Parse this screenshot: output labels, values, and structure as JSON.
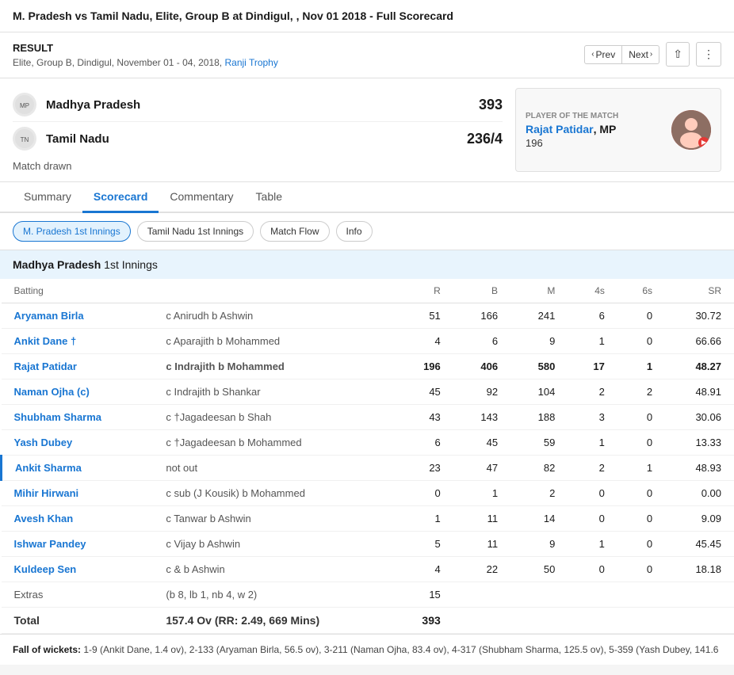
{
  "page": {
    "title": "M. Pradesh vs Tamil Nadu, Elite, Group B at Dindigul, , Nov 01 2018 - Full Scorecard"
  },
  "result": {
    "label": "RESULT",
    "sub": "Elite, Group B, Dindigul, November 01 - 04, 2018,",
    "link_text": "Ranji Trophy",
    "prev_label": "Prev",
    "next_label": "Next"
  },
  "teams": [
    {
      "name": "Madhya Pradesh",
      "score": "393",
      "logo_text": "MP"
    },
    {
      "name": "Tamil Nadu",
      "score": "236/4",
      "logo_text": "TN"
    }
  ],
  "match_result": "Match drawn",
  "player_of_match": {
    "label": "PLAYER OF THE MATCH",
    "name": "Rajat Patidar",
    "team": ", MP",
    "score": "196"
  },
  "tabs": [
    {
      "id": "summary",
      "label": "Summary"
    },
    {
      "id": "scorecard",
      "label": "Scorecard",
      "active": true
    },
    {
      "id": "commentary",
      "label": "Commentary"
    },
    {
      "id": "table",
      "label": "Table"
    }
  ],
  "innings_tabs": [
    {
      "id": "mp1",
      "label": "M. Pradesh 1st Innings",
      "active": true
    },
    {
      "id": "tn1",
      "label": "Tamil Nadu 1st Innings"
    },
    {
      "id": "matchflow",
      "label": "Match Flow"
    },
    {
      "id": "info",
      "label": "Info"
    }
  ],
  "innings": {
    "title_team": "Madhya Pradesh",
    "title_suffix": "1st Innings",
    "batting_headers": {
      "batting": "Batting",
      "r": "R",
      "b": "B",
      "m": "M",
      "fours": "4s",
      "sixes": "6s",
      "sr": "SR"
    },
    "batsmen": [
      {
        "name": "Aryaman Birla",
        "dismissal": "c Anirudh b Ashwin",
        "r": "51",
        "b": "166",
        "m": "241",
        "4s": "6",
        "6s": "0",
        "sr": "30.72",
        "bold": false,
        "highlight_left": false
      },
      {
        "name": "Ankit Dane †",
        "dismissal": "c Aparajith b Mohammed",
        "r": "4",
        "b": "6",
        "m": "9",
        "4s": "1",
        "6s": "0",
        "sr": "66.66",
        "bold": false,
        "highlight_left": false
      },
      {
        "name": "Rajat Patidar",
        "dismissal": "c Indrajith b Mohammed",
        "r": "196",
        "b": "406",
        "m": "580",
        "4s": "17",
        "6s": "1",
        "sr": "48.27",
        "bold": true,
        "highlight_left": false
      },
      {
        "name": "Naman Ojha (c)",
        "dismissal": "c Indrajith b Shankar",
        "r": "45",
        "b": "92",
        "m": "104",
        "4s": "2",
        "6s": "2",
        "sr": "48.91",
        "bold": false,
        "highlight_left": false
      },
      {
        "name": "Shubham Sharma",
        "dismissal": "c †Jagadeesan b Shah",
        "r": "43",
        "b": "143",
        "m": "188",
        "4s": "3",
        "6s": "0",
        "sr": "30.06",
        "bold": false,
        "highlight_left": false
      },
      {
        "name": "Yash Dubey",
        "dismissal": "c †Jagadeesan b Mohammed",
        "r": "6",
        "b": "45",
        "m": "59",
        "4s": "1",
        "6s": "0",
        "sr": "13.33",
        "bold": false,
        "highlight_left": false
      },
      {
        "name": "Ankit Sharma",
        "dismissal": "not out",
        "r": "23",
        "b": "47",
        "m": "82",
        "4s": "2",
        "6s": "1",
        "sr": "48.93",
        "bold": false,
        "highlight_left": true
      },
      {
        "name": "Mihir Hirwani",
        "dismissal": "c sub (J Kousik) b Mohammed",
        "r": "0",
        "b": "1",
        "m": "2",
        "4s": "0",
        "6s": "0",
        "sr": "0.00",
        "bold": false,
        "highlight_left": false
      },
      {
        "name": "Avesh Khan",
        "dismissal": "c Tanwar b Ashwin",
        "r": "1",
        "b": "11",
        "m": "14",
        "4s": "0",
        "6s": "0",
        "sr": "9.09",
        "bold": false,
        "highlight_left": false
      },
      {
        "name": "Ishwar Pandey",
        "dismissal": "c Vijay b Ashwin",
        "r": "5",
        "b": "11",
        "m": "9",
        "4s": "1",
        "6s": "0",
        "sr": "45.45",
        "bold": false,
        "highlight_left": false
      },
      {
        "name": "Kuldeep Sen",
        "dismissal": "c & b Ashwin",
        "r": "4",
        "b": "22",
        "m": "50",
        "4s": "0",
        "6s": "0",
        "sr": "18.18",
        "bold": false,
        "highlight_left": false
      }
    ],
    "extras_label": "Extras",
    "extras_detail": "(b 8, lb 1, nb 4, w 2)",
    "extras_val": "15",
    "total_label": "Total",
    "total_detail": "157.4 Ov (RR: 2.49, 669 Mins)",
    "total_val": "393",
    "fall_of_wickets_label": "Fall of wickets:",
    "fall_of_wickets_text": "1-9 (Ankit Dane, 1.4 ov), 2-133 (Aryaman Birla, 56.5 ov), 3-211 (Naman Ojha, 83.4 ov), 4-317 (Shubham Sharma, 125.5 ov), 5-359 (Yash Dubey, 141.6"
  }
}
